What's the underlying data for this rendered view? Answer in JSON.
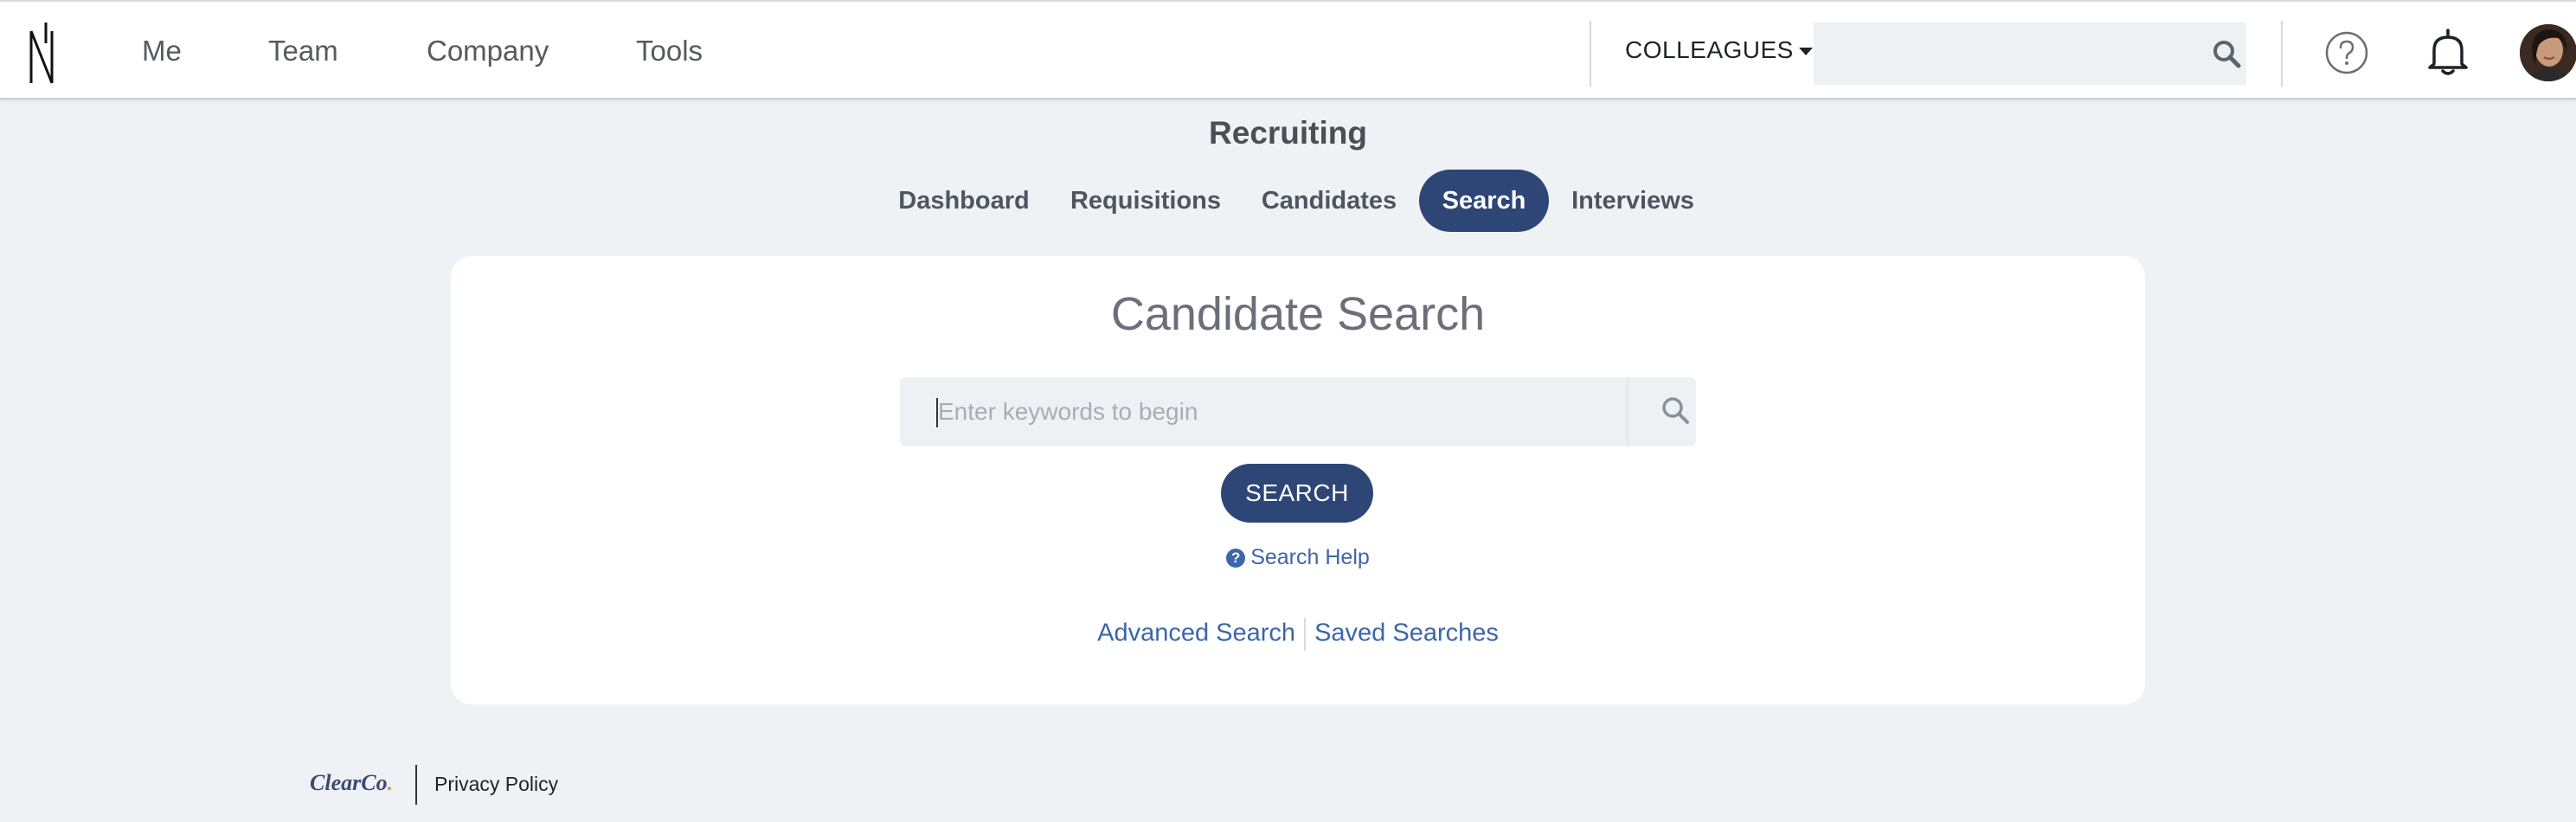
{
  "nav": {
    "links": [
      "Me",
      "Team",
      "Company",
      "Tools"
    ],
    "colleagues_label": "COLLEAGUES",
    "search_value": ""
  },
  "section": {
    "title": "Recruiting",
    "tabs": [
      "Dashboard",
      "Requisitions",
      "Candidates",
      "Search",
      "Interviews"
    ],
    "active_tab": "Search"
  },
  "card": {
    "title": "Candidate Search",
    "search_placeholder": "Enter keywords to begin",
    "search_button": "SEARCH",
    "help_link": "Search Help",
    "advanced_search": "Advanced Search",
    "saved_searches": "Saved Searches"
  },
  "footer": {
    "logo_text": "ClearCo",
    "privacy_policy": "Privacy Policy"
  },
  "colors": {
    "accent": "#2d4676",
    "link": "#3c66a8",
    "background": "#eff2f5"
  },
  "icons": [
    "app-logo-icon",
    "search-icon",
    "help-circle-icon",
    "bell-icon",
    "question-icon"
  ]
}
